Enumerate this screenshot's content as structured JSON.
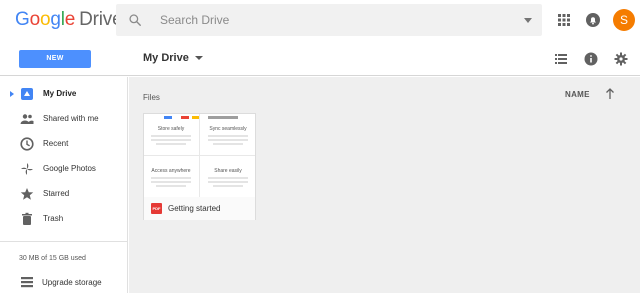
{
  "header": {
    "logo_letters": [
      "G",
      "o",
      "o",
      "g",
      "l",
      "e"
    ],
    "product": "Drive",
    "search_placeholder": "Search Drive",
    "icons": [
      "search-icon",
      "dropdown-caret-icon",
      "apps-grid-icon",
      "notifications-bell-icon"
    ],
    "avatar_letter": "S"
  },
  "toolbar": {
    "new_label": "NEW",
    "location": "My Drive",
    "icons": [
      "list-view-icon",
      "info-icon",
      "settings-gear-icon"
    ]
  },
  "sidebar": {
    "items": [
      {
        "label": "My Drive",
        "icon": "drive-icon",
        "active": true
      },
      {
        "label": "Shared with me",
        "icon": "people-icon",
        "active": false
      },
      {
        "label": "Recent",
        "icon": "clock-icon",
        "active": false
      },
      {
        "label": "Google Photos",
        "icon": "pinwheel-icon",
        "active": false
      },
      {
        "label": "Starred",
        "icon": "star-icon",
        "active": false
      },
      {
        "label": "Trash",
        "icon": "trash-icon",
        "active": false
      }
    ],
    "usage": "30 MB of 15 GB used",
    "upgrade_label": "Upgrade storage"
  },
  "main": {
    "section_label": "Files",
    "sort_label": "NAME",
    "files": [
      {
        "name": "Getting started",
        "type_badge": "PDF",
        "thumb_sections": [
          "Store safely",
          "Sync seamlessly",
          "Access anywhere",
          "Share easily"
        ]
      }
    ]
  },
  "colors": {
    "accent_blue": "#4285f4",
    "new_button": "#4d90fe",
    "avatar": "#f57c00",
    "pdf_red": "#e53935"
  }
}
